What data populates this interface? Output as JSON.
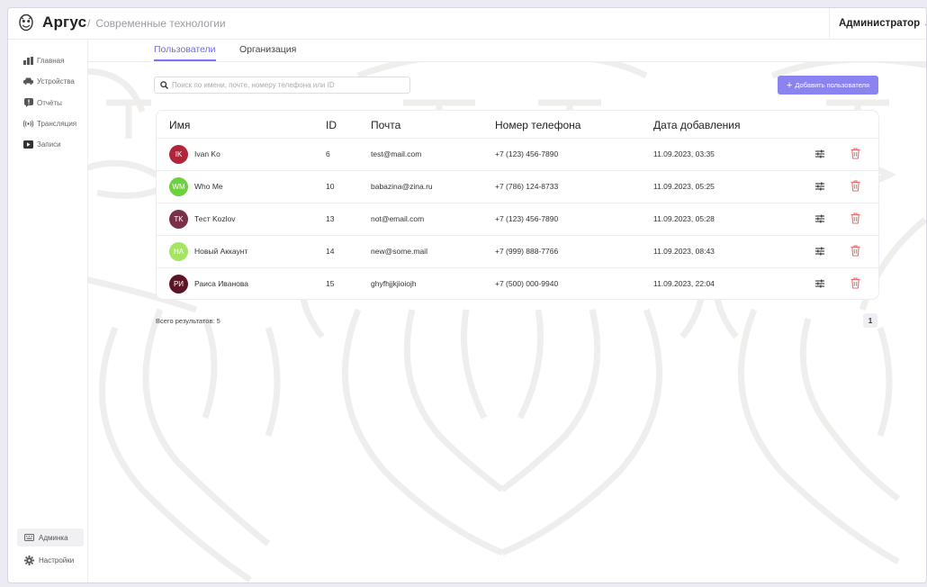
{
  "app": {
    "title": "Аргус",
    "breadcrumb": "Современные технологии"
  },
  "user": {
    "name": "Администратор"
  },
  "sidebar": {
    "items": [
      {
        "label": "Главная",
        "icon": "bar-chart-icon"
      },
      {
        "label": "Устройства",
        "icon": "car-icon"
      },
      {
        "label": "Отчёты",
        "icon": "message-icon"
      },
      {
        "label": "Трансляция",
        "icon": "broadcast-icon"
      },
      {
        "label": "Записи",
        "icon": "play-icon"
      }
    ],
    "admin_label": "Админка",
    "settings_label": "Настройки"
  },
  "tabs": [
    {
      "label": "Пользователи",
      "active": true
    },
    {
      "label": "Организация",
      "active": false
    }
  ],
  "search": {
    "placeholder": "Поиск по имени, почте, номеру телефона или ID",
    "value": ""
  },
  "add_button": {
    "label": "Добавить пользователя"
  },
  "table": {
    "headers": {
      "name": "Имя",
      "id": "ID",
      "email": "Почта",
      "phone": "Номер телефона",
      "date": "Дата добавления"
    },
    "rows": [
      {
        "initials": "IK",
        "color": "#b0253a",
        "name": "Ivan Ko",
        "id": "6",
        "email": "test@mail.com",
        "phone": "+7 (123) 456-7890",
        "date": "11.09.2023, 03:35"
      },
      {
        "initials": "WM",
        "color": "#6cd23b",
        "name": "Who Me",
        "id": "10",
        "email": "babazina@zina.ru",
        "phone": "+7 (786) 124-8733",
        "date": "11.09.2023, 05:25"
      },
      {
        "initials": "TK",
        "color": "#7a3049",
        "name": "Тест Kozlov",
        "id": "13",
        "email": "not@email.com",
        "phone": "+7 (123) 456-7890",
        "date": "11.09.2023, 05:28"
      },
      {
        "initials": "НА",
        "color": "#a6e463",
        "name": "Новый Аккаунт",
        "id": "14",
        "email": "new@some.mail",
        "phone": "+7 (999) 888-7766",
        "date": "11.09.2023, 08:43"
      },
      {
        "initials": "РИ",
        "color": "#5d1526",
        "name": "Раиса Иванова",
        "id": "15",
        "email": "ghyfhjjkjioiojh",
        "phone": "+7 (500) 000-9940",
        "date": "11.09.2023, 22:04"
      }
    ]
  },
  "footer": {
    "total_label": "Всего результатов: 5",
    "page": "1"
  },
  "colors": {
    "accent": "#7c74ee",
    "button": "#8a83f0",
    "delete": "#ef6a6a"
  }
}
